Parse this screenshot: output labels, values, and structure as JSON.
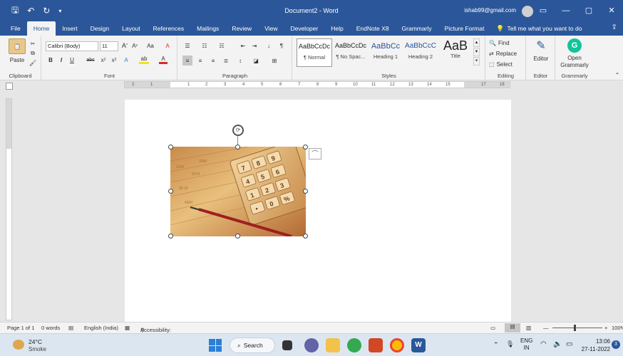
{
  "title_bar": {
    "document_title": "Document2 - Word",
    "user_email": "ishab99@gmail.com",
    "qat_icons": [
      "save-icon",
      "undo-icon",
      "redo-icon",
      "customize-icon"
    ]
  },
  "tabs": [
    "File",
    "Home",
    "Insert",
    "Design",
    "Layout",
    "References",
    "Mailings",
    "Review",
    "View",
    "Developer",
    "Help",
    "EndNote X8",
    "Grammarly",
    "Picture Format"
  ],
  "tell_me": "Tell me what you want to do",
  "ribbon": {
    "clipboard": {
      "paste": "Paste",
      "label": "Clipboard"
    },
    "font": {
      "name": "Calibri (Body)",
      "size": "11",
      "label": "Font"
    },
    "paragraph": {
      "label": "Paragraph"
    },
    "styles": {
      "label": "Styles",
      "items": [
        {
          "sample": "AaBbCcDc",
          "name": "¶ Normal"
        },
        {
          "sample": "AaBbCcDc",
          "name": "¶ No Spac..."
        },
        {
          "sample": "AaBbCc",
          "name": "Heading 1"
        },
        {
          "sample": "AaBbCcC",
          "name": "Heading 2"
        },
        {
          "sample": "AaB",
          "name": "Title"
        }
      ]
    },
    "editing": {
      "find": "Find",
      "replace": "Replace",
      "select": "Select",
      "label": "Editing"
    },
    "editor": {
      "button": "Editor",
      "label": "Editor"
    },
    "grammarly": {
      "button_line1": "Open",
      "button_line2": "Grammarly",
      "label": "Grammarly"
    }
  },
  "ruler_numbers": [
    "2",
    "1",
    "1",
    "2",
    "3",
    "4",
    "5",
    "6",
    "7",
    "8",
    "9",
    "10",
    "11",
    "12",
    "13",
    "14",
    "15",
    "17",
    "18"
  ],
  "status": {
    "page": "Page 1 of 1",
    "words": "0 words",
    "language": "English (India)",
    "accessibility": "Accessibility: Investigate",
    "zoom": "100%"
  },
  "taskbar": {
    "temp": "24°C",
    "weather": "Smoke",
    "search": "Search",
    "lang1": "ENG",
    "lang2": "IN",
    "time": "13:06",
    "date": "27-11-2022",
    "notifications": "3"
  }
}
